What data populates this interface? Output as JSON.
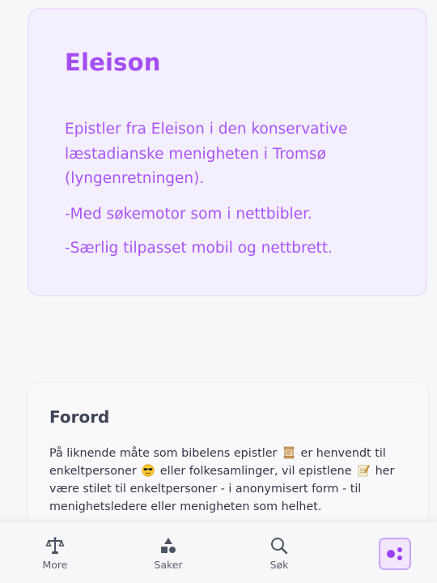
{
  "hero": {
    "title": "Eleison",
    "description": "Epistler fra Eleison i den konservative læstadianske menigheten i Tromsø (lyngenretningen).",
    "line1": "-Med søkemotor som i nettbibler.",
    "line2": "-Særlig tilpasset mobil og nettbrett."
  },
  "foreword": {
    "title": "Forord",
    "text_part1": "På liknende måte som bibelens epistler",
    "text_part2": "er henvendt til enkeltpersoner",
    "text_part3": "eller folkesamlinger, vil epistlene",
    "text_part4": "her være stilet til enkeltpersoner - i anonymisert form - til menighetsledere eller menigheten som helhet.",
    "icons": [
      "scroll-icon",
      "cool-face-icon",
      "memo-icon"
    ]
  },
  "bottom_nav": {
    "items": [
      {
        "label": "More",
        "icon": "balance-scale-icon"
      },
      {
        "label": "Saker",
        "icon": "shapes-icon"
      },
      {
        "label": "Søk",
        "icon": "search-icon"
      },
      {
        "label": "",
        "icon": "dots-icon",
        "active": true
      }
    ]
  },
  "colors": {
    "accent": "#a855f7",
    "hero_background": "#f4efff",
    "page_background": "#f7f7fa"
  }
}
